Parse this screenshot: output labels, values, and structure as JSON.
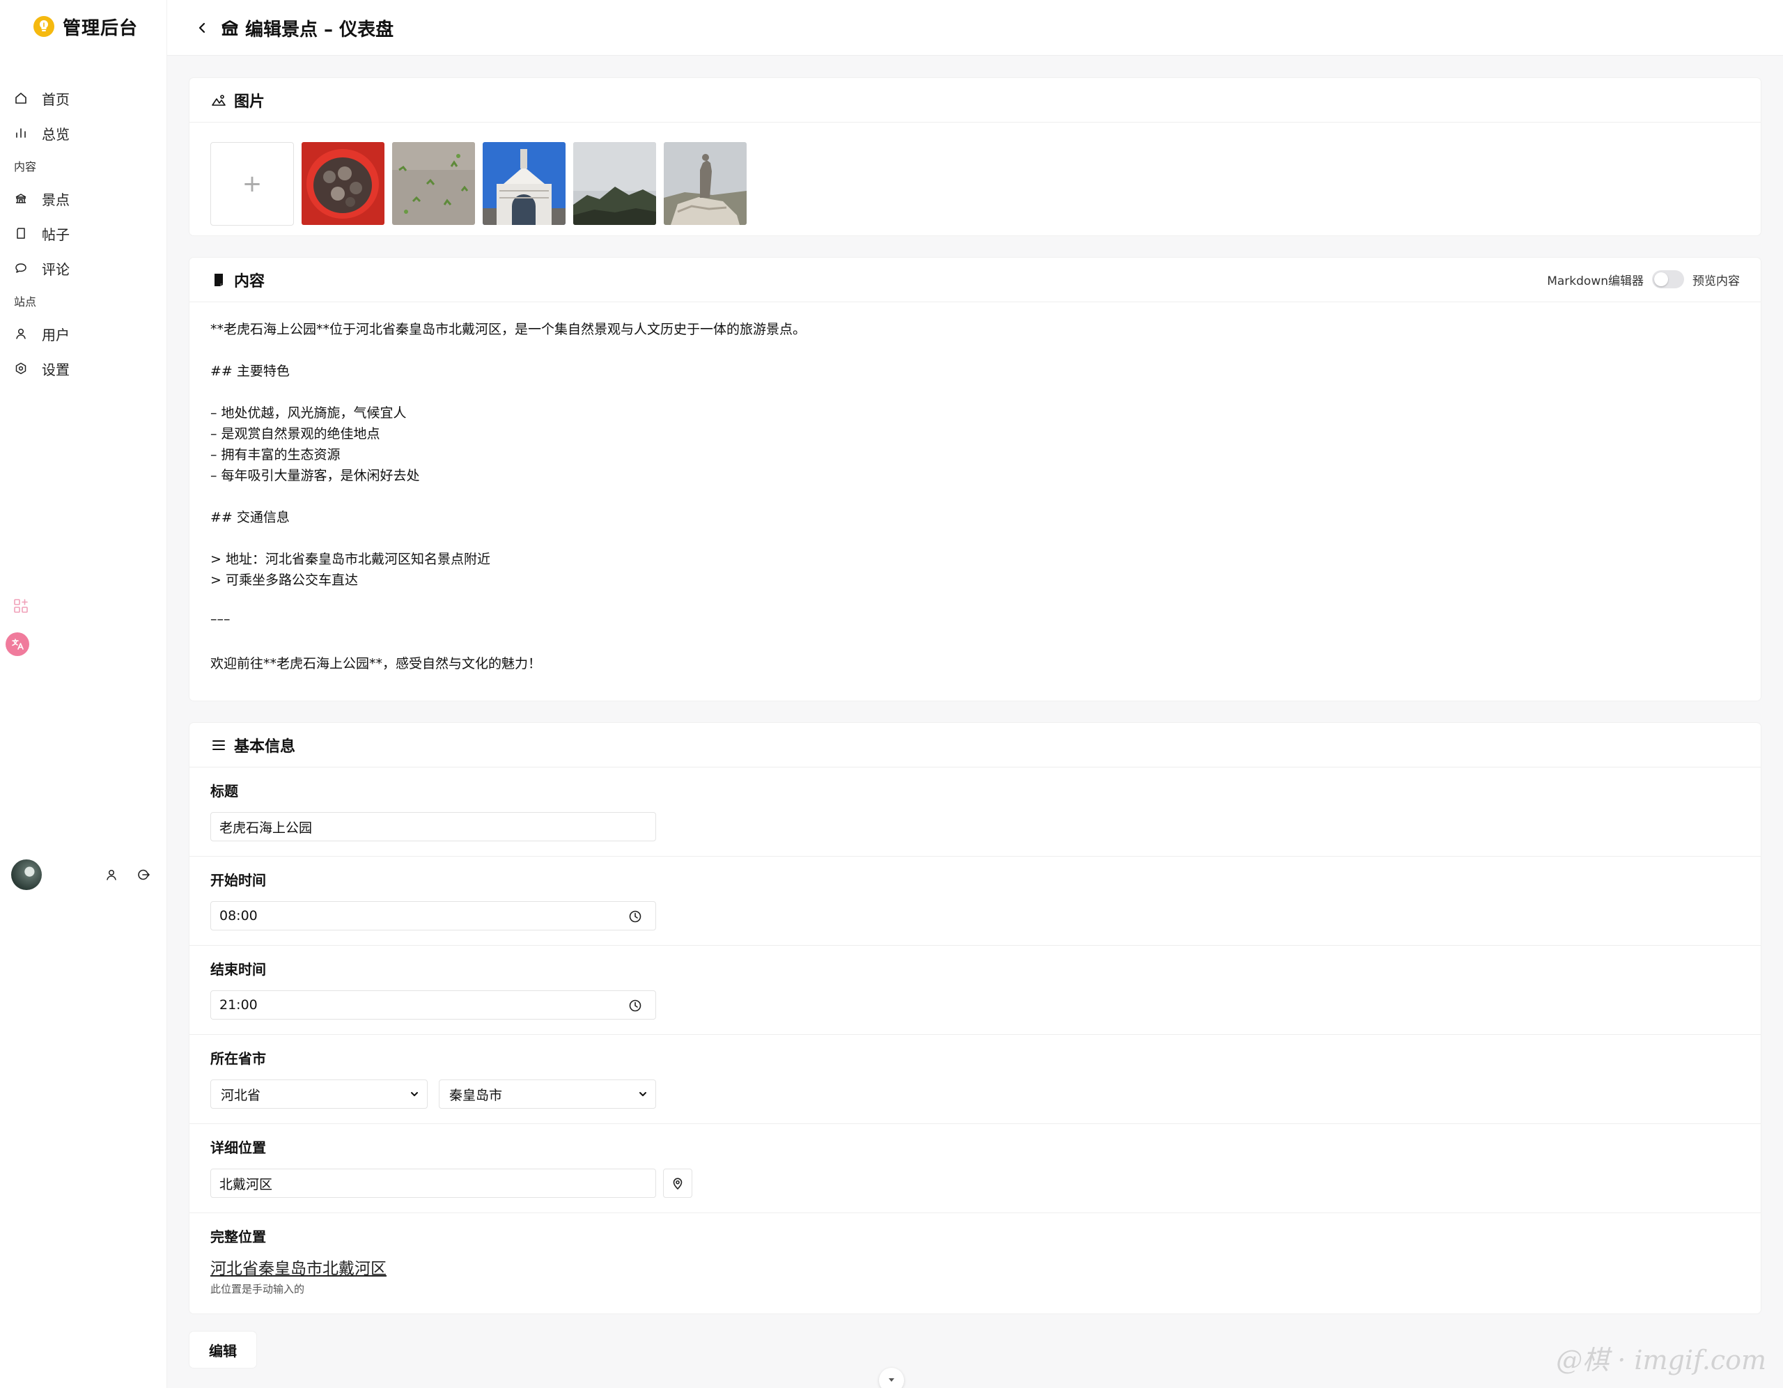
{
  "brand": {
    "title": "管理后台",
    "accent": "#f5b90f"
  },
  "nav": {
    "home": "首页",
    "overview": "总览",
    "section_content": "内容",
    "attractions": "景点",
    "posts": "帖子",
    "comments": "评论",
    "section_site": "站点",
    "users": "用户",
    "settings": "设置"
  },
  "header": {
    "title": "编辑景点 – 仪表盘"
  },
  "images_card": {
    "title": "图片",
    "upload_symbol": "+",
    "thumbnails": [
      "crab-bowl-photo",
      "muddy-shore-photo",
      "white-tower-gate-photo",
      "coastal-hill-photo",
      "statue-on-rocks-photo"
    ]
  },
  "content_card": {
    "title": "内容",
    "markdown_label": "Markdown编辑器",
    "preview_label": "预览内容",
    "markdown_enabled": false,
    "lines": [
      "**老虎石海上公园**位于河北省秦皇岛市北戴河区，是一个集自然景观与人文历史于一体的旅游景点。",
      "## 主要特色",
      "– 地处优越，风光旖旎，气候宜人",
      "– 是观赏自然景观的绝佳地点",
      "– 拥有丰富的生态资源",
      "– 每年吸引大量游客，是休闲好去处",
      "## 交通信息",
      "> 地址：河北省秦皇岛市北戴河区知名景点附近",
      "> 可乘坐多路公交车直达",
      "–––",
      "欢迎前往**老虎石海上公园**，感受自然与文化的魅力！"
    ]
  },
  "basic_info": {
    "title": "基本信息",
    "title_label": "标题",
    "title_value": "老虎石海上公园",
    "start_label": "开始时间",
    "start_value": "08:00",
    "end_label": "结束时间",
    "end_value": "21:00",
    "province_city_label": "所在省市",
    "province_value": "河北省",
    "city_value": "秦皇岛市",
    "detail_label": "详细位置",
    "detail_value": "北戴河区",
    "full_label": "完整位置",
    "full_value": "河北省秦皇岛市北戴河区",
    "full_hint": "此位置是手动输入的"
  },
  "edit_button": "编辑",
  "watermark": "@棋 · imgif.com"
}
